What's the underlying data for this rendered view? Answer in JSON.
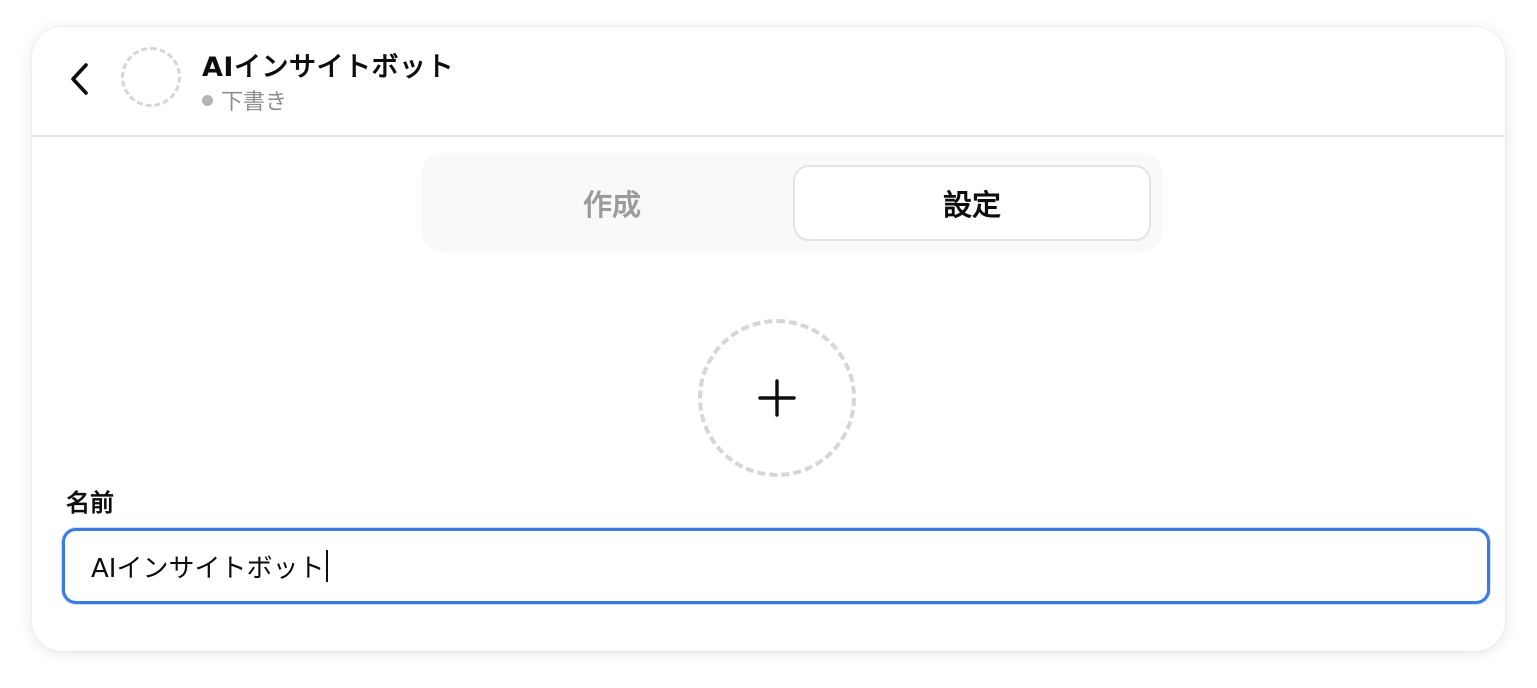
{
  "header": {
    "back_icon": "chevron-left-icon",
    "title": "AIインサイトボット",
    "status": "下書き",
    "status_color": "#b4b4b4"
  },
  "tabs": [
    {
      "label": "作成",
      "active": false
    },
    {
      "label": "設定",
      "active": true
    }
  ],
  "avatar_upload": {
    "icon": "plus-icon"
  },
  "name_field": {
    "label": "名前",
    "value": "AIインサイトボット"
  },
  "colors": {
    "focus_border": "#3b7bdf",
    "inactive_tab_text": "#9b9b9b"
  }
}
